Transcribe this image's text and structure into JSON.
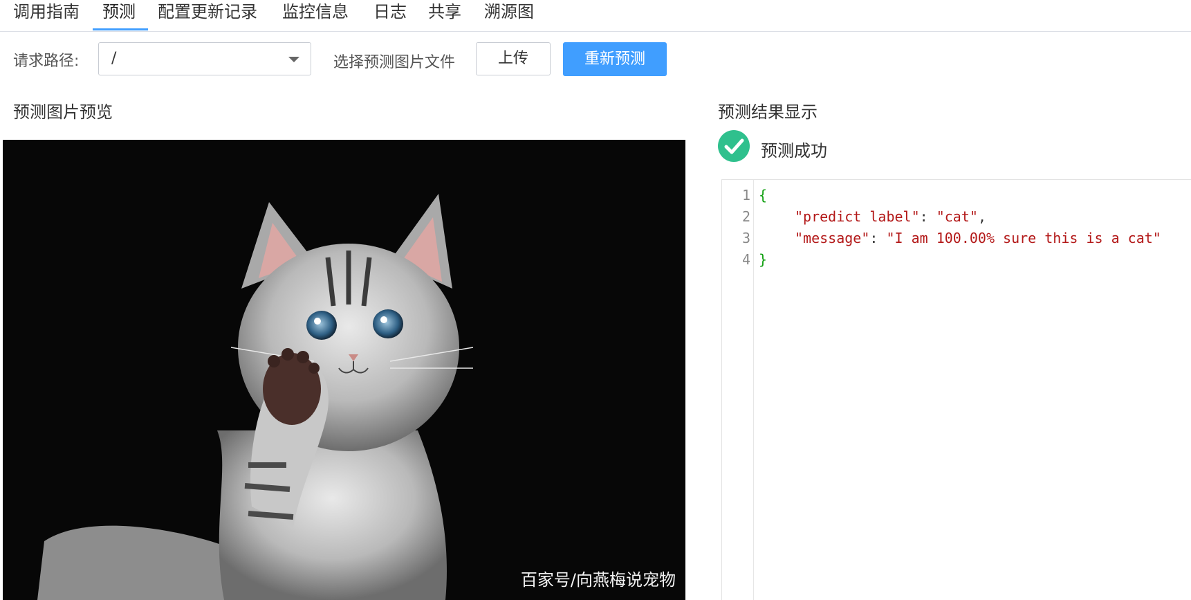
{
  "tabs": [
    {
      "label": "调用指南"
    },
    {
      "label": "预测"
    },
    {
      "label": "配置更新记录"
    },
    {
      "label": "监控信息"
    },
    {
      "label": "日志"
    },
    {
      "label": "共享"
    },
    {
      "label": "溯源图"
    }
  ],
  "active_tab": "预测",
  "toolbar": {
    "path_label": "请求路径:",
    "path_value": "/",
    "file_label": "选择预测图片文件",
    "upload_label": "上传",
    "repredict_label": "重新预测"
  },
  "preview": {
    "title": "预测图片预览",
    "watermark": "百家号/向燕梅说宠物"
  },
  "result": {
    "title": "预测结果显示",
    "status_text": "预测成功",
    "status_icon": "check-circle-icon",
    "status_color": "#2fc08d"
  },
  "code": {
    "line_numbers": [
      "1",
      "2",
      "3",
      "4"
    ],
    "open_brace": "{",
    "close_brace": "}",
    "entries": [
      {
        "key": "\"predict label\"",
        "sep": ": ",
        "value": "\"cat\"",
        "end": ","
      },
      {
        "key": "\"message\"",
        "sep": ": ",
        "value": "\"I am 100.00% sure this is a cat\"",
        "end": ""
      }
    ]
  },
  "colors": {
    "accent": "#409eff",
    "json_brace": "#11a011",
    "json_string": "#b31818"
  }
}
